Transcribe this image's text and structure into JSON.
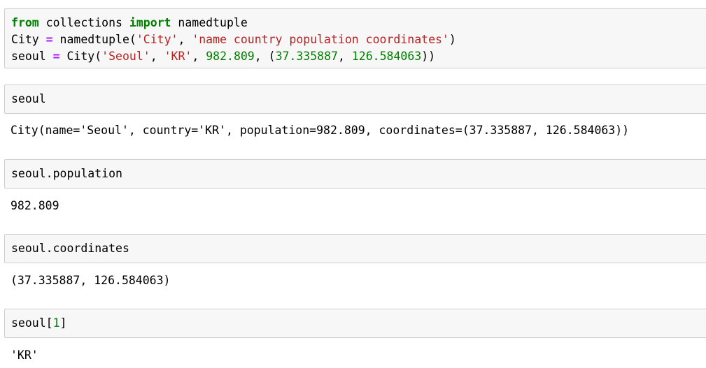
{
  "cells": [
    {
      "input": {
        "line1": {
          "kw_from": "from",
          "t1": " collections ",
          "kw_import": "import",
          "t2": " namedtuple"
        },
        "line2": {
          "t1": "City ",
          "op": "=",
          "t2": " namedtuple(",
          "s1": "'City'",
          "t3": ", ",
          "s2": "'name country population coordinates'",
          "t4": ")"
        },
        "line3": {
          "t1": "seoul ",
          "op": "=",
          "t2": " City(",
          "s1": "'Seoul'",
          "t3": ", ",
          "s2": "'KR'",
          "t4": ", ",
          "n1": "982.809",
          "t5": ", (",
          "n2": "37.335887",
          "t6": ", ",
          "n3": "126.584063",
          "t7": "))"
        }
      }
    },
    {
      "input": {
        "code": "seoul"
      },
      "output": "City(name='Seoul', country='KR', population=982.809, coordinates=(37.335887, 126.584063))"
    },
    {
      "input": {
        "code": "seoul.population"
      },
      "output": "982.809"
    },
    {
      "input": {
        "code": "seoul.coordinates"
      },
      "output": "(37.335887, 126.584063)"
    },
    {
      "input": {
        "t1": "seoul[",
        "n1": "1",
        "t2": "]"
      },
      "output": "'KR'"
    }
  ],
  "colors": {
    "keyword": "#008000",
    "string": "#ba2121",
    "number": "#008000",
    "operator": "#aa22ff",
    "input_background": "#f7f7f7",
    "input_border": "#cfcfcf"
  }
}
